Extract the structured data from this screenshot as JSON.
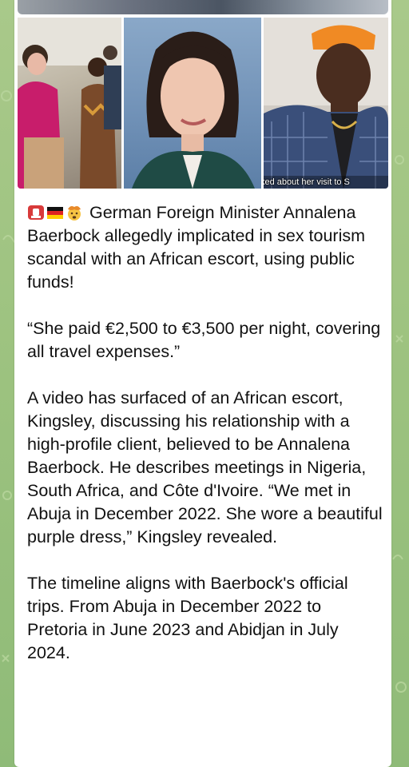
{
  "colors": {
    "chat_background": "#9cc27f",
    "bubble": "#ffffff",
    "text": "#111111"
  },
  "media": {
    "photos": [
      {
        "icon": "photo-group-market"
      },
      {
        "icon": "photo-portrait-woman"
      },
      {
        "icon": "photo-man-orange-cap",
        "caption": "ked about her visit to S"
      }
    ]
  },
  "message": {
    "emojis": [
      "rotating-light-emoji",
      "german-flag-emoji",
      "exploding-head-emoji"
    ],
    "headline": "German Foreign Minister Annalena Baerbock allegedly implicated in sex tourism scandal with an African escort, using public funds!",
    "quote": "“She paid €2,500 to €3,500 per night, covering all travel expenses.”",
    "paragraph_1": "A video has surfaced of an African escort, Kingsley, discussing his relationship with a high-profile client, believed to be Annalena Baerbock. He describes meetings in Nigeria, South Africa, and Côte d'Ivoire. “We met in Abuja in December 2022. She wore a beautiful purple dress,” Kingsley revealed.",
    "paragraph_2": "The timeline aligns with Baerbock's official trips. From Abuja in December 2022 to Pretoria in June 2023 and Abidjan in July 2024."
  }
}
